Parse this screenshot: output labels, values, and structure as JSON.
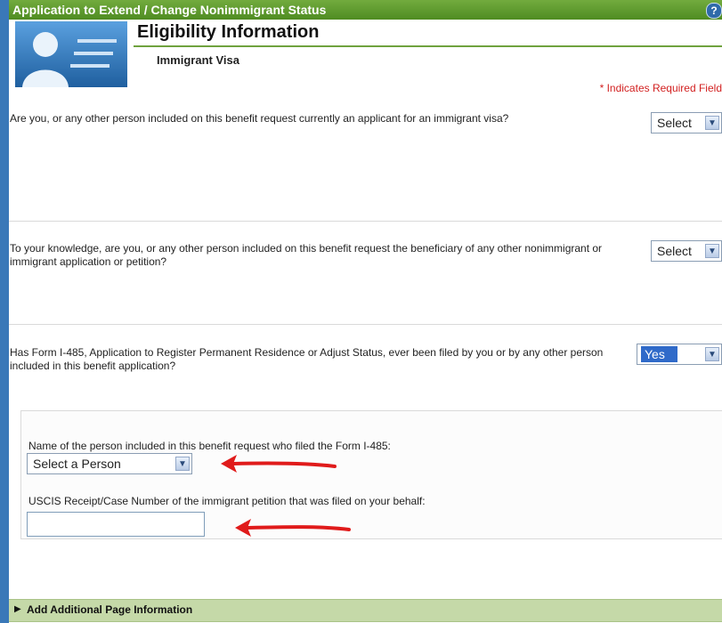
{
  "window": {
    "title": "Application to Extend / Change Nonimmigrant Status",
    "help_glyph": "?"
  },
  "page": {
    "section_title": "Eligibility Information",
    "subtitle": "Immigrant Visa",
    "required_note": "* Indicates Required Field"
  },
  "questions": [
    {
      "text": "Are you, or any other person included on this benefit request currently an applicant for an immigrant visa?",
      "selected": "Select"
    },
    {
      "text": "To your knowledge, are you, or any other person included on this benefit request the beneficiary of any other nonimmigrant or immigrant application or petition?",
      "selected": "Select"
    },
    {
      "text": "Has Form I-485, Application to Register Permanent Residence or Adjust Status, ever been filed by you or by any other person included in this benefit application?",
      "selected": "Yes"
    }
  ],
  "followup": {
    "person_label": "Name of the person included in this benefit request who filed the Form I-485:",
    "person_selected": "Select a Person",
    "receipt_label": "USCIS Receipt/Case Number of the immigrant petition that was filed on your behalf:",
    "receipt_value": ""
  },
  "footer": {
    "label": "Add Additional Page Information"
  },
  "colors": {
    "title_bar": "#4f8c22",
    "required": "#d21f1f",
    "annotation_arrow": "#e01b1b",
    "footer_bar": "#c5d9a8"
  }
}
